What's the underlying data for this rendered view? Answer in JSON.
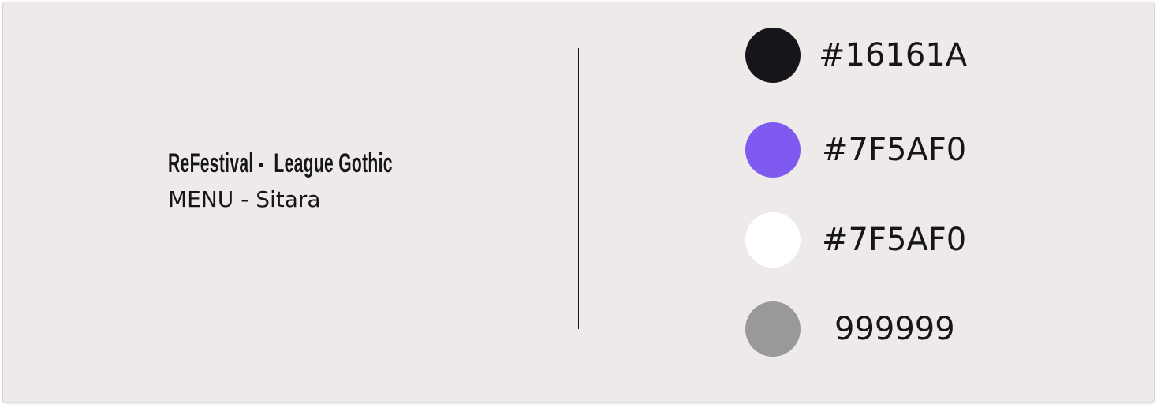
{
  "typography": {
    "title": "ReFestival -  League Gothic",
    "subtitle": "MENU - Sitara"
  },
  "palette": [
    {
      "label": "#16161A",
      "color": "#16161A"
    },
    {
      "label": "#7F5AF0",
      "color": "#7F5AF0"
    },
    {
      "label": "#7F5AF0",
      "color": "#FFFFFF"
    },
    {
      "label": "999999",
      "color": "#999999"
    }
  ]
}
